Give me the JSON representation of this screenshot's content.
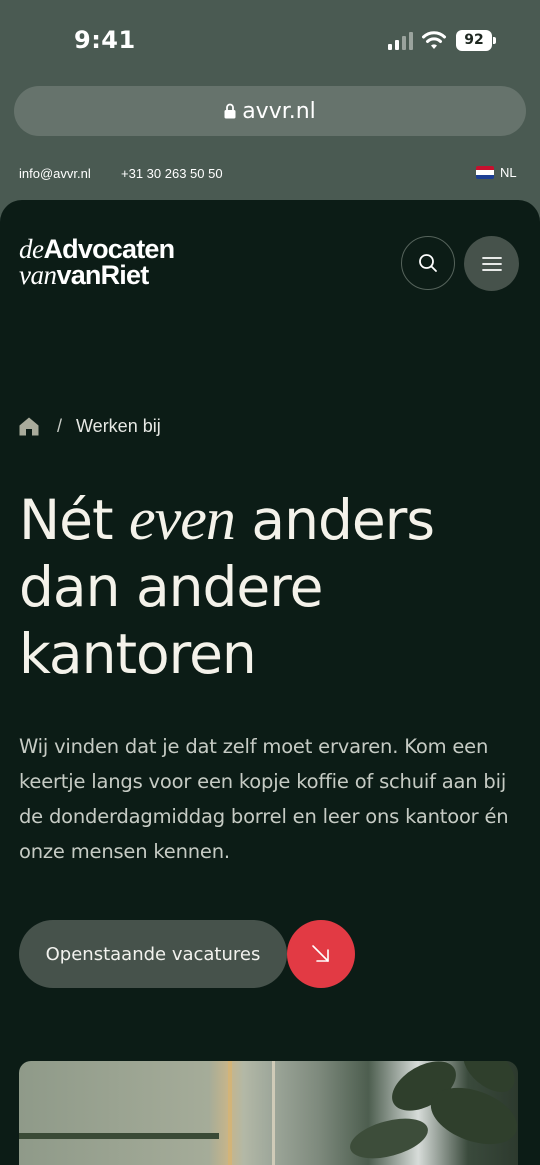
{
  "status_bar": {
    "time": "9:41",
    "battery": "92"
  },
  "browser": {
    "url": "avvr.nl"
  },
  "topbar": {
    "email": "info@avvr.nl",
    "phone": "+31 30 263 50 50",
    "language": "NL"
  },
  "header": {
    "logo_line1_italic": "de",
    "logo_line1_bold": "Advocaten",
    "logo_line2_italic": "van",
    "logo_line2_bold": "vanRiet",
    "search_icon": "search-icon",
    "menu_icon": "hamburger-menu-icon"
  },
  "breadcrumb": {
    "home_icon": "home-icon",
    "separator": "/",
    "current": "Werken bij"
  },
  "hero": {
    "headline_part1": "Nét ",
    "headline_emphasis": "even",
    "headline_part2": " anders dan andere kantoren",
    "intro": "Wij vinden dat je dat zelf moet ervaren. Kom een keertje langs voor een kopje koffie of schuif aan bij de donderdagmiddag borrel en leer ons kantoor én onze mensen kennen.",
    "cta_label": "Openstaande vacatures",
    "cta_icon": "arrow-down-right-icon"
  },
  "colors": {
    "background": "#0c1c16",
    "accent": "#e23a44",
    "button": "#46524b"
  }
}
